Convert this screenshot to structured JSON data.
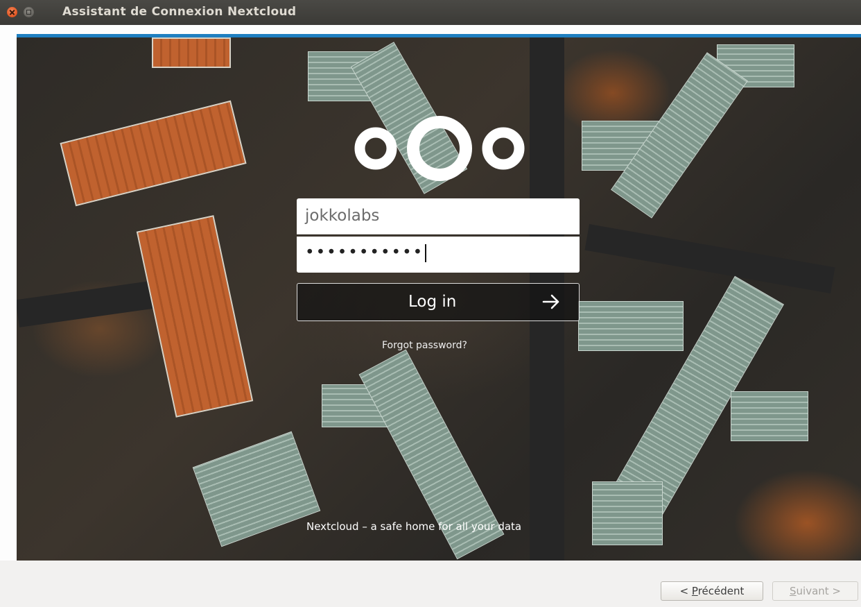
{
  "window": {
    "title": "Assistant de Connexion Nextcloud"
  },
  "login": {
    "username": "jokkolabs",
    "password_mask": "•••••••••••",
    "login_label": "Log in",
    "forgot_label": "Forgot password?",
    "footer_text": "Nextcloud – a safe home for all your data"
  },
  "nav": {
    "prev_prefix": "< ",
    "prev_accel": "P",
    "prev_rest": "récédent",
    "next_accel": "S",
    "next_rest": "uivant >"
  },
  "colors": {
    "accent": "#1f7fc0",
    "titlebar": "#3b3a36",
    "close_button": "#e2531f"
  }
}
